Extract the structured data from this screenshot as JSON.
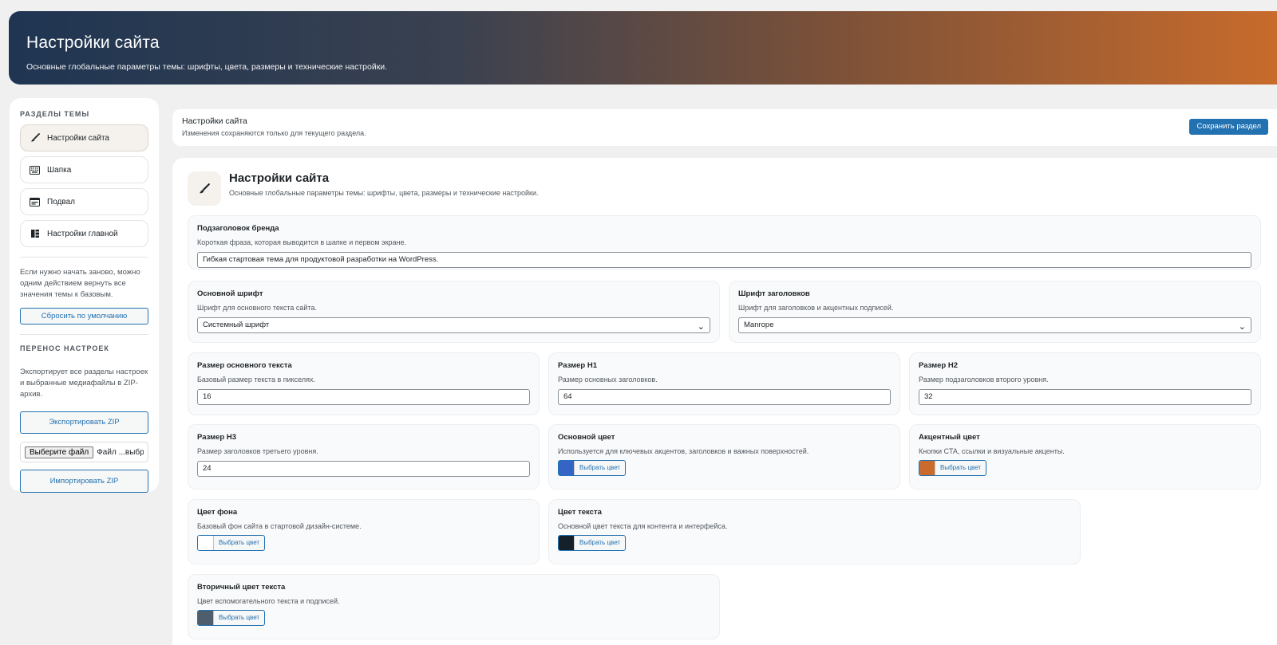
{
  "hero": {
    "title": "Настройки сайта",
    "subtitle": "Основные глобальные параметры темы: шрифты, цвета, размеры и технические настройки."
  },
  "sidebar": {
    "sections_heading": "РАЗДЕЛЫ ТЕМЫ",
    "items": [
      {
        "label": "Настройки сайта",
        "icon": "brush-icon",
        "active": true
      },
      {
        "label": "Шапка",
        "icon": "keyboard-icon",
        "active": false
      },
      {
        "label": "Подвал",
        "icon": "footer-icon",
        "active": false
      },
      {
        "label": "Настройки главной",
        "icon": "layout-icon",
        "active": false
      }
    ],
    "reset_note": "Если нужно начать заново, можно одним действием вернуть все значения темы к базовым.",
    "reset_label": "Сбросить по умолчанию",
    "transfer_heading": "ПЕРЕНОС НАСТРОЕК",
    "transfer_note": "Экспортирует все разделы настроек и выбранные медиафайлы в ZIP-архив.",
    "export_label": "Экспортировать ZIP",
    "file_button": "Выберите файл",
    "file_status": "Файл ...выбран",
    "import_label": "Импортировать ZIP"
  },
  "topbar": {
    "title": "Настройки сайта",
    "note": "Изменения сохраняются только для текущего раздела.",
    "save_label": "Сохранить раздел"
  },
  "panel": {
    "title": "Настройки сайта",
    "subtitle": "Основные глобальные параметры темы: шрифты, цвета, размеры и технические настройки.",
    "brand": {
      "label": "Подзаголовок бренда",
      "desc": "Короткая фраза, которая выводится в шапке и первом экране.",
      "value": "Гибкая стартовая тема для продуктовой разработки на WordPress."
    },
    "font_main": {
      "label": "Основной шрифт",
      "desc": "Шрифт для основного текста сайта.",
      "value": "Системный шрифт"
    },
    "font_head": {
      "label": "Шрифт заголовков",
      "desc": "Шрифт для заголовков и акцентных подписей.",
      "value": "Manrope"
    },
    "size_body": {
      "label": "Размер основного текста",
      "desc": "Базовый размер текста в пикселях.",
      "value": "16"
    },
    "size_h1": {
      "label": "Размер H1",
      "desc": "Размер основных заголовков.",
      "value": "64"
    },
    "size_h2": {
      "label": "Размер H2",
      "desc": "Размер подзаголовков второго уровня.",
      "value": "32"
    },
    "size_h3": {
      "label": "Размер H3",
      "desc": "Размер заголовков третьего уровня.",
      "value": "24"
    },
    "color_primary": {
      "label": "Основной цвет",
      "desc": "Используется для ключевых акцентов, заголовков и важных поверхностей.",
      "button": "Выбрать цвет",
      "color": "#3465c4"
    },
    "color_accent": {
      "label": "Акцентный цвет",
      "desc": "Кнопки CTA, ссылки и визуальные акценты.",
      "button": "Выбрать цвет",
      "color": "#c86b2c"
    },
    "color_bg": {
      "label": "Цвет фона",
      "desc": "Базовый фон сайта в стартовой дизайн-системе.",
      "button": "Выбрать цвет",
      "color": "#ffffff"
    },
    "color_text": {
      "label": "Цвет текста",
      "desc": "Основной цвет текста для контента и интерфейса.",
      "button": "Выбрать цвет",
      "color": "#14212b"
    },
    "color_text2": {
      "label": "Вторичный цвет текста",
      "desc": "Цвет вспомогательного текста и подписей.",
      "button": "Выбрать цвет",
      "color": "#4f5e6d"
    }
  }
}
